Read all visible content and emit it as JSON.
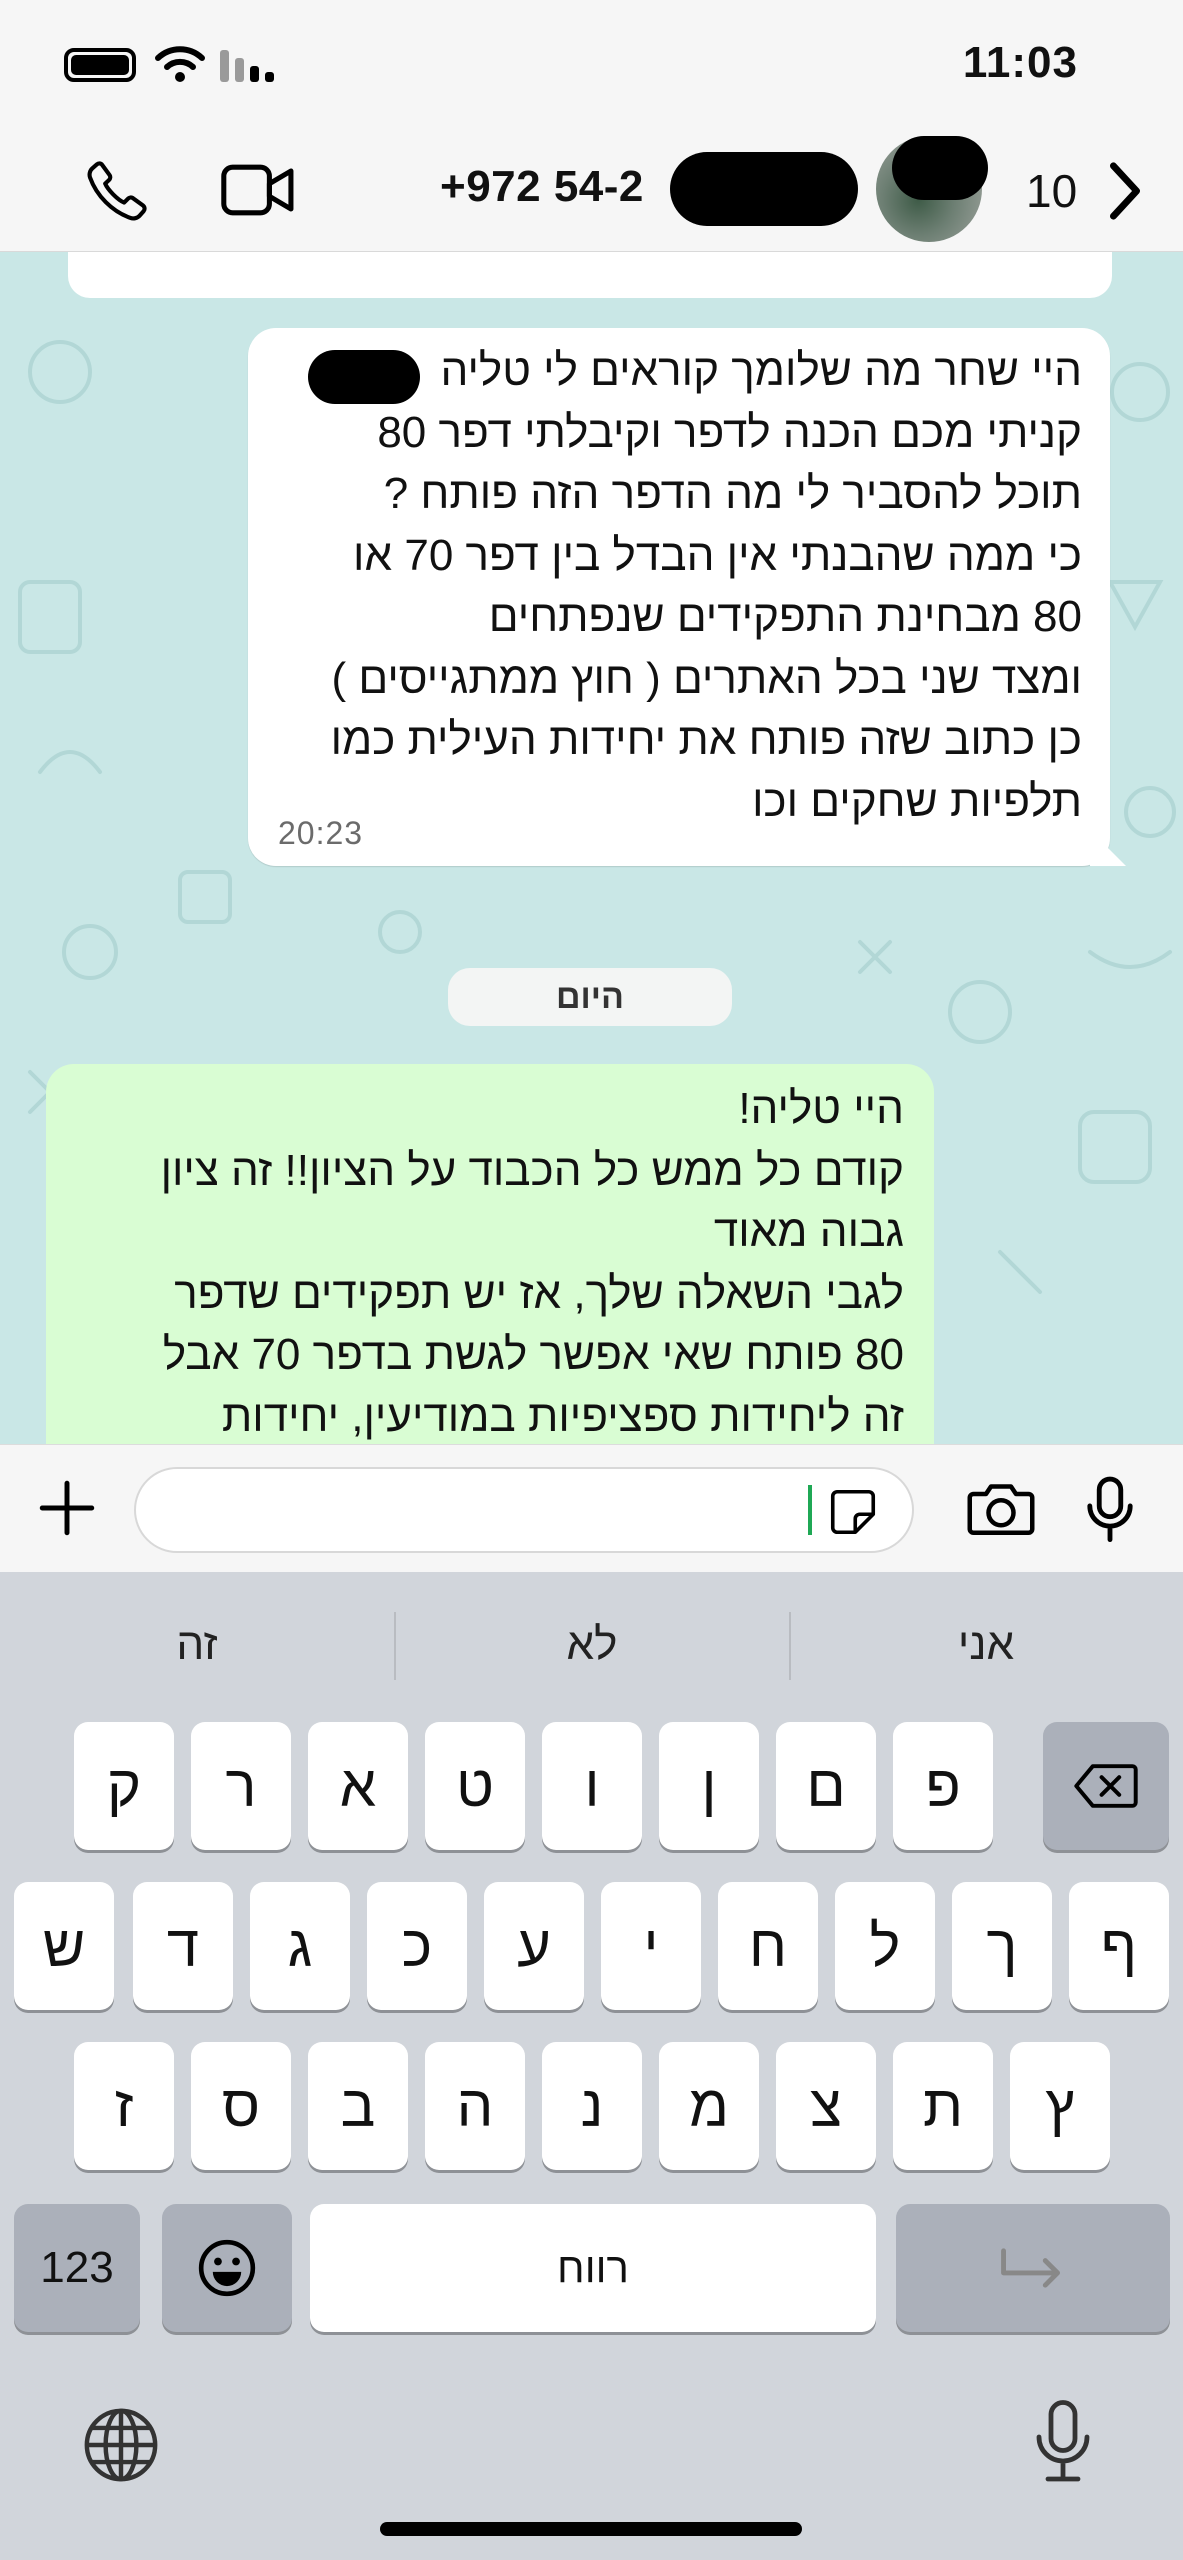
{
  "status_bar": {
    "time": "11:03"
  },
  "header": {
    "contact_name": "+972 54-2",
    "back_count": "10",
    "icons": [
      "phone-icon",
      "video-icon",
      "chevron-right-icon"
    ]
  },
  "chat": {
    "incoming": {
      "text": "היי שחר מה שלומך קוראים לי טליה\nקניתי מכם הכנה לדפר וקיבלתי דפר 80\nתוכל להסביר לי מה הדפר הזה פותח ?\nכי ממה שהבנתי אין הבדל בין דפר 70 או\n80 מבחינת התפקידים שנפתחים\nומצד שני בכל האתרים ( חוץ ממתגייסים )\nכן כתוב שזה פותח את יחידות העילית כמו\nתלפיות שחקים וכו",
      "time": "20:23"
    },
    "date_divider": "היום",
    "outgoing": {
      "text": "היי טליה!\nקודם כל ממש כל הכבוד על הציון!! זה ציון\nגבוה מאוד\nלגבי השאלה שלך, אז יש תפקידים שדפר\n80 פותח שאי אפשר לגשת בדפר 70 אבל\nזה ליחידות ספציפיות במודיעין, יחידות"
    }
  },
  "input_bar": {
    "placeholder": ""
  },
  "keyboard": {
    "suggestions": [
      "אני",
      "לא",
      "זה"
    ],
    "row1": [
      "פ",
      "ם",
      "ן",
      "ו",
      "ט",
      "א",
      "ר",
      "ק"
    ],
    "row2": [
      "ף",
      "ך",
      "ל",
      "ח",
      "י",
      "ע",
      "כ",
      "ג",
      "ד",
      "ש"
    ],
    "row3": [
      "ץ",
      "ת",
      "צ",
      "מ",
      "נ",
      "ה",
      "ב",
      "ס",
      "ז"
    ],
    "numbers_key": "123",
    "space_key": "רווח"
  },
  "colors": {
    "chat_background": "#c9e7e6",
    "outgoing_bubble": "#d9fdd3",
    "incoming_bubble": "#ffffff",
    "cursor": "#1fa855"
  }
}
